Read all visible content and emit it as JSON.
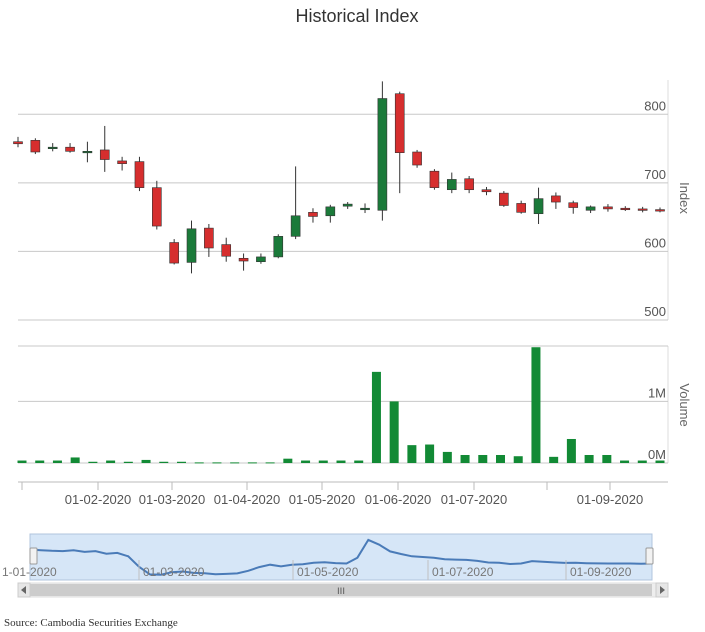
{
  "title": "Historical Index",
  "source_label": "Source: Cambodia Securities Exchange",
  "colors": {
    "up": "#1b7a3a",
    "down": "#d62e2e",
    "volume": "#128a35",
    "nav_line": "#4a7bb8",
    "nav_fill": "#d6e6f7",
    "grid": "#c8c8c8"
  },
  "chart_data": [
    {
      "type": "candlestick",
      "title": "Historical Index",
      "ylabel": "Index",
      "ylim": [
        500,
        850
      ],
      "yticks": [
        "500",
        "600",
        "700",
        "800"
      ],
      "x_tick_labels": [
        "01-02-2020",
        "01-03-2020",
        "01-04-2020",
        "01-05-2020",
        "01-06-2020",
        "01-07-2020",
        "01-09-2020"
      ],
      "candles": [
        {
          "o": 760,
          "h": 767,
          "l": 752,
          "c": 757
        },
        {
          "o": 762,
          "h": 765,
          "l": 742,
          "c": 745
        },
        {
          "o": 750,
          "h": 758,
          "l": 746,
          "c": 752
        },
        {
          "o": 752,
          "h": 758,
          "l": 744,
          "c": 746
        },
        {
          "o": 745,
          "h": 760,
          "l": 730,
          "c": 746
        },
        {
          "o": 748,
          "h": 783,
          "l": 716,
          "c": 734
        },
        {
          "o": 732,
          "h": 738,
          "l": 718,
          "c": 728
        },
        {
          "o": 731,
          "h": 738,
          "l": 688,
          "c": 693
        },
        {
          "o": 693,
          "h": 703,
          "l": 632,
          "c": 637
        },
        {
          "o": 613,
          "h": 618,
          "l": 581,
          "c": 583
        },
        {
          "o": 584,
          "h": 645,
          "l": 568,
          "c": 633
        },
        {
          "o": 634,
          "h": 640,
          "l": 592,
          "c": 605
        },
        {
          "o": 610,
          "h": 620,
          "l": 585,
          "c": 593
        },
        {
          "o": 590,
          "h": 597,
          "l": 572,
          "c": 586
        },
        {
          "o": 585,
          "h": 597,
          "l": 582,
          "c": 592
        },
        {
          "o": 592,
          "h": 625,
          "l": 590,
          "c": 622
        },
        {
          "o": 622,
          "h": 724,
          "l": 618,
          "c": 652
        },
        {
          "o": 657,
          "h": 663,
          "l": 642,
          "c": 651
        },
        {
          "o": 652,
          "h": 668,
          "l": 642,
          "c": 665
        },
        {
          "o": 666,
          "h": 672,
          "l": 662,
          "c": 669
        },
        {
          "o": 662,
          "h": 670,
          "l": 656,
          "c": 663
        },
        {
          "o": 660,
          "h": 848,
          "l": 645,
          "c": 823
        },
        {
          "o": 830,
          "h": 833,
          "l": 685,
          "c": 744
        },
        {
          "o": 745,
          "h": 748,
          "l": 722,
          "c": 726
        },
        {
          "o": 717,
          "h": 720,
          "l": 690,
          "c": 693
        },
        {
          "o": 690,
          "h": 715,
          "l": 685,
          "c": 705
        },
        {
          "o": 706,
          "h": 710,
          "l": 685,
          "c": 690
        },
        {
          "o": 690,
          "h": 694,
          "l": 682,
          "c": 687
        },
        {
          "o": 685,
          "h": 688,
          "l": 665,
          "c": 667
        },
        {
          "o": 670,
          "h": 674,
          "l": 655,
          "c": 657
        },
        {
          "o": 655,
          "h": 693,
          "l": 640,
          "c": 677
        },
        {
          "o": 681,
          "h": 686,
          "l": 662,
          "c": 672
        },
        {
          "o": 671,
          "h": 674,
          "l": 655,
          "c": 664
        },
        {
          "o": 660,
          "h": 667,
          "l": 656,
          "c": 665
        },
        {
          "o": 665,
          "h": 669,
          "l": 658,
          "c": 662
        },
        {
          "o": 663,
          "h": 666,
          "l": 659,
          "c": 661
        },
        {
          "o": 662,
          "h": 665,
          "l": 657,
          "c": 660
        },
        {
          "o": 661,
          "h": 664,
          "l": 657,
          "c": 660
        }
      ]
    },
    {
      "type": "bar",
      "ylabel": "Volume",
      "yticks": [
        "0M",
        "1M"
      ],
      "ylim": [
        0,
        1900000
      ],
      "values": [
        40000,
        40000,
        40000,
        90000,
        20000,
        40000,
        20000,
        50000,
        20000,
        20000,
        10000,
        10000,
        10000,
        10000,
        10000,
        70000,
        40000,
        40000,
        40000,
        40000,
        1480000,
        1000000,
        290000,
        300000,
        180000,
        130000,
        130000,
        130000,
        110000,
        1880000,
        100000,
        390000,
        130000,
        130000,
        40000,
        40000,
        40000
      ]
    },
    {
      "type": "area",
      "role": "navigator",
      "x_tick_labels": [
        "1-01-2020",
        "01-03-2020",
        "01-05-2020",
        "01-07-2020",
        "01-09-2020"
      ],
      "values": [
        757,
        752,
        748,
        746,
        752,
        740,
        746,
        728,
        733,
        710,
        637,
        585,
        583,
        600,
        605,
        595,
        593,
        586,
        588,
        592,
        610,
        635,
        652,
        640,
        651,
        655,
        665,
        669,
        663,
        660,
        700,
        823,
        790,
        744,
        726,
        710,
        705,
        700,
        690,
        687,
        685,
        678,
        667,
        665,
        657,
        660,
        677,
        672,
        668,
        664,
        665,
        662,
        661,
        660,
        660,
        660,
        659,
        660
      ]
    }
  ]
}
